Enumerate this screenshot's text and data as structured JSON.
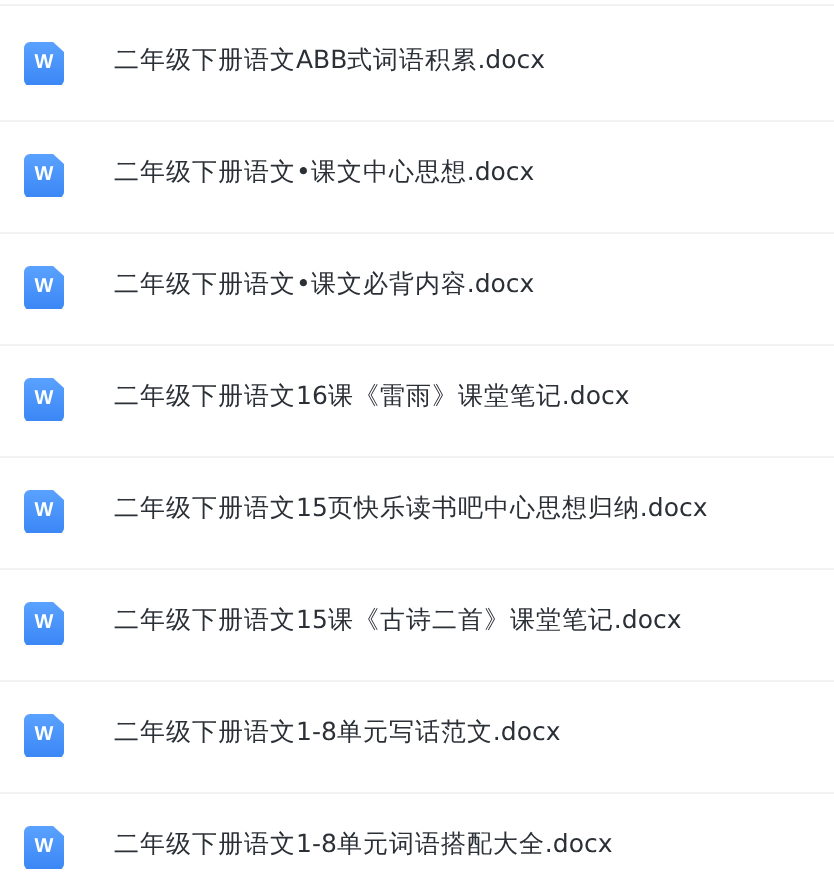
{
  "files": [
    {
      "name": "二年级下册语文ABB式词语积累.docx",
      "icon": "W"
    },
    {
      "name": "二年级下册语文•课文中心思想.docx",
      "icon": "W"
    },
    {
      "name": "二年级下册语文•课文必背内容.docx",
      "icon": "W"
    },
    {
      "name": "二年级下册语文16课《雷雨》课堂笔记.docx",
      "icon": "W"
    },
    {
      "name": "二年级下册语文15页快乐读书吧中心思想归纳.docx",
      "icon": "W"
    },
    {
      "name": "二年级下册语文15课《古诗二首》课堂笔记.docx",
      "icon": "W"
    },
    {
      "name": "二年级下册语文1-8单元写话范文.docx",
      "icon": "W"
    },
    {
      "name": "二年级下册语文1-8单元词语搭配大全.docx",
      "icon": "W"
    }
  ]
}
